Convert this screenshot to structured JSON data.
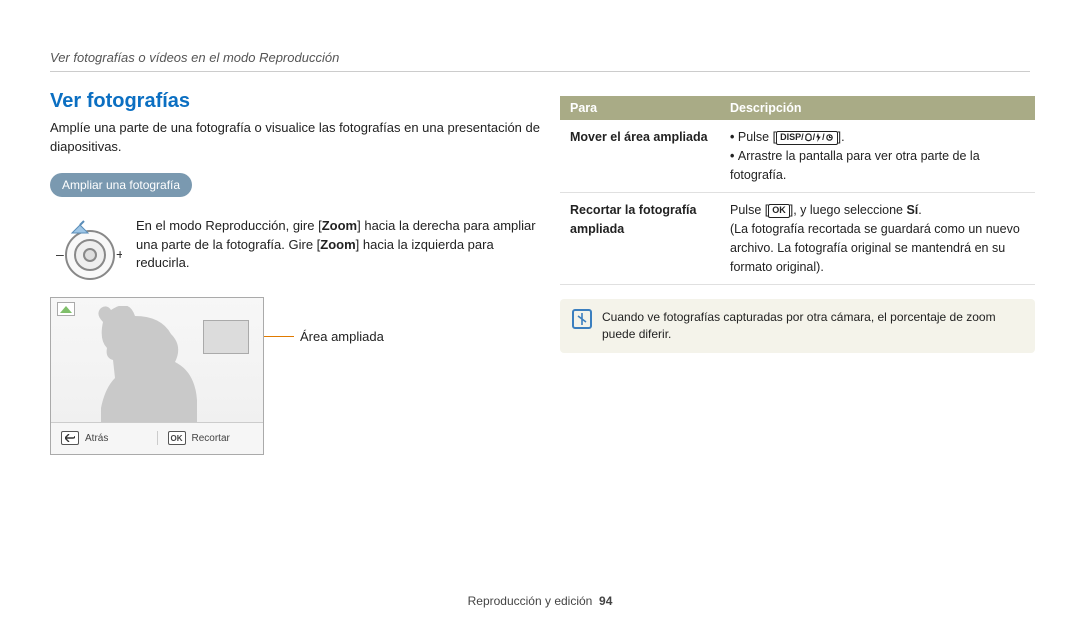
{
  "header": {
    "breadcrumb": "Ver fotografías o vídeos en el modo Reproducción"
  },
  "left": {
    "title": "Ver fotografías",
    "intro": "Amplíe una parte de una fotografía o visualice las fotografías en una presentación de diapositivas.",
    "pill": "Ampliar una fotografía",
    "dial_text_pre": "En el modo Reproducción, gire [",
    "dial_zoom1": "Zoom",
    "dial_text_mid": "] hacia la derecha para ampliar una parte de la fotografía. Gire [",
    "dial_zoom2": "Zoom",
    "dial_text_post": "] hacia la izquierda para reducirla.",
    "leader_label": "Área ampliada",
    "bar": {
      "back": "Atrás",
      "ok_key": "OK",
      "recortar": "Recortar"
    }
  },
  "table": {
    "head": {
      "col1": "Para",
      "col2": "Descripción"
    },
    "rows": [
      {
        "k": "Mover el área ampliada",
        "bullet1_pre": "Pulse [",
        "bullet1_key": "DISP",
        "bullet1_post": "].",
        "bullet2": "Arrastre la pantalla para ver otra parte de la fotografía."
      },
      {
        "k": "Recortar la fotografía ampliada",
        "line_pre": "Pulse [",
        "line_key": "OK",
        "line_mid": "], y luego seleccione ",
        "line_bold": "Sí",
        "line_post": ".",
        "line2": "(La fotografía recortada se guardará como un nuevo archivo. La fotografía original se mantendrá en su formato original)."
      }
    ]
  },
  "note": "Cuando ve fotografías capturadas por otra cámara, el porcentaje de zoom puede diferir.",
  "footer": {
    "section": "Reproducción y edición",
    "page": "94"
  }
}
